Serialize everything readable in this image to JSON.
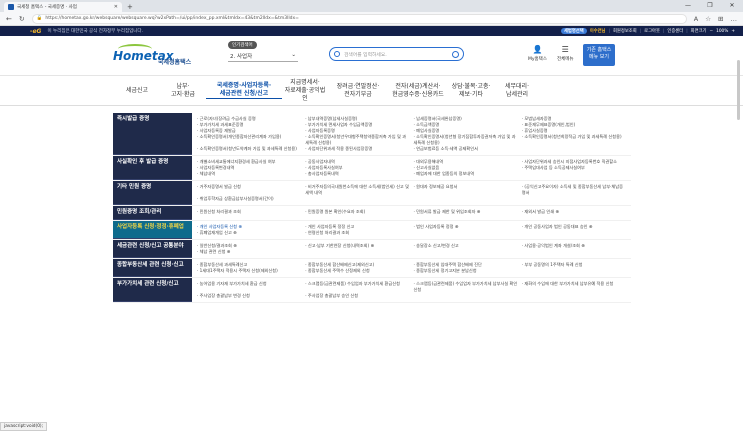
{
  "tab": {
    "title": "국세청 홈택스 - 국세증명 · 사업",
    "close": "✕",
    "new": "+"
  },
  "window": {
    "min": "—",
    "max": "❐",
    "close": "✕"
  },
  "address": {
    "url": "https://hometax.go.kr/websquare/websquare.wq?w2xPath=/ui/pp/index_pp.xml&tmIdx=43&tm2lIdx=&tm3lIdx="
  },
  "banner": {
    "eg": "-eG",
    "text": "이 누리집은 대한민국 공식 전자정부 누리집입니다.",
    "pill": "세법명선택",
    "user": "이수연님",
    "items": [
      "회원정보조회",
      "로그아웃",
      "인증센터",
      "화면크기"
    ],
    "zoom": "100%"
  },
  "header": {
    "logo_main": "Hometax",
    "logo_sub": "국세청홈택스",
    "role_tag": "인기검색어",
    "role_value": "2. 사업자",
    "search_placeholder": "검색어를 입력하세요.",
    "my": "My홈택스",
    "menu": "전체메뉴",
    "kibon1": "기존 홈택스",
    "kibon2": "메뉴 보기"
  },
  "gnb": [
    [
      "세금신고",
      ""
    ],
    [
      "납부·",
      "고지·환급"
    ],
    [
      "국세증명·사업자등록·",
      "세금관련 신청/신고"
    ],
    [
      "지급명세서·",
      "자료제출·공익법인"
    ],
    [
      "장려금·연말정산·",
      "전자기부금"
    ],
    [
      "전자(세금)계산서·",
      "현금영수증·신용카드"
    ],
    [
      "상담·불복·고충·",
      "제보·기타"
    ],
    [
      "세무대리·",
      "납세관리"
    ]
  ],
  "side_button": "메뉴얼펼침 출력",
  "rows": [
    {
      "title": "즉시발급 증명",
      "active": false,
      "links": [
        "· 근로(자녀)장려금 수급사실 증명",
        "· 납부내역증명(납세사실증명)",
        "· 납세증명서(국세완납증명)",
        "· 모범납세자증명",
        "· 부가가치세 과세표준증명",
        "· 부가가치세 면세사업자 수입금액증명",
        "· 소득금액증명",
        "· 표준재무제표증명(개인,법인)",
        "· 사업자등록증 재발급",
        "· 사업자등록증명",
        "· 폐업사실증명",
        "· 휴업사실증명",
        "· 소득확인증명서(개인종합자산관리계좌 가입용)",
        "· 소득확인증명서(청년우대형주택청약종합저축 가입 및 과세특례 신청용)",
        "· 소득확인증명서(청년형 장기집합투자증권저축 가입 및 과세특례 신청용)",
        "· 소득확인증명서(청년희망적금 가입 및 과세특례 신청용)",
        "· 소득확인증명서(청년도약계좌 가입 및 과세특례 신청용)",
        "· 사업자단위과세 적용 종된사업장증명",
        "· 연금보험료등 소득·세액 공제확인서",
        ""
      ]
    },
    {
      "title": "사실확인 후 발급 증명",
      "active": false,
      "links": [
        "· 개별소비세교통에너지환경세 환급사실 여부",
        "· 공동사업자내역",
        "· 대외무용해내역",
        "· 사업자단위과세 승인시 지점사업자등록번호 직권할소",
        "· 사업자등록변경내역",
        "· 사업자등록사실여부",
        "· 신고사실없음",
        "· 주택임대사업 등 소득공제사실여부",
        "· 체납내역",
        "· 총사업자등록내역",
        "· 폐업자에 대한 업종등의 정보내역",
        ""
      ]
    },
    {
      "title": "기타 민원 증명",
      "active": false,
      "links": [
        "· 거주자증명서 발급 신청",
        "· 비거주자등의국내원천소득에 대한 소득세(법인세) 신고 및 세액 내역",
        "· 원대자 정보제공 요청서",
        "· (공익신고주요이자) 소득세 및 종합부동산세 납부·체납증명서",
        "· 취업후학자금 상환금납부사실증명서(간이)",
        "",
        "",
        ""
      ]
    },
    {
      "title": "민원증명 조회/관리",
      "active": false,
      "links": [
        "· 민원신청 처리결과 조회",
        "· 민원증명 원본 확인(수요자 조회)",
        "· 민원서류 발급 제한 및 위임조회자 ⊕",
        "· 재외서 발급 인쇄 ⊕"
      ]
    },
    {
      "title": "사업자등록 신청·정정·휴폐업",
      "active": true,
      "links": [
        "· 개인 사업자등록 신청 ⊕",
        "· 개인 사업자등록 정정 신고",
        "· 법인 사업자등록 정정 ⊕",
        "· 개인 공동사업자 법인 공동대표 승인 ⊕",
        "· 휴폐업재개업 신고 ⊕",
        "· 연령신청 처리결과 조회",
        "",
        ""
      ]
    },
    {
      "title": "세금관련 신청/신고 공통분야",
      "active": false,
      "links": [
        "· 일반신청/결과조회 ⊕",
        "· 신고·납부 기한연장 신청(내역조회) ⊕",
        "· 송달장소 신고/변경 신고",
        "· 사업용·공익법인 계좌 개설/조회 ⊕",
        "· 체납 관련 신청 ⊕",
        "",
        "",
        ""
      ]
    },
    {
      "title": "종합부동산세 관련 신청·신고",
      "active": false,
      "links": [
        "· 종합부동산세 과세특례신고",
        "· 종합부동산세 합산배제신고(제외신고)",
        "· 종합부동산세 임대주택 합산배제 진단",
        "· 부부 공동명의 1주택자 특례 신청",
        "· 1세대1주택자 적용시 주택자 신청(제외신청)",
        "· 종합부동산세 주택수 산정제외 신청",
        "· 종합부동산세 정기고지분 분납신청",
        ""
      ]
    },
    {
      "title": "부가가치세 관련 신청/신고",
      "active": false,
      "links": [
        "· 농어업용 기자재 부가가치세 환급 신청",
        "· 스크랩등(금관련제품) 수입업자 부가가치세 환급신청",
        "· 스크랩등(금관련제품) 수입업자 부가가치세 납부사실 확인신청",
        "· 재화의 수입에 대한 부가가치세 납부유예 적용 신청",
        "· 주사업장 총괄납부 변경 신청",
        "· 주사업장 총괄납부 승인 신청",
        "",
        ""
      ]
    }
  ],
  "status_text": "javascript:void(0);"
}
